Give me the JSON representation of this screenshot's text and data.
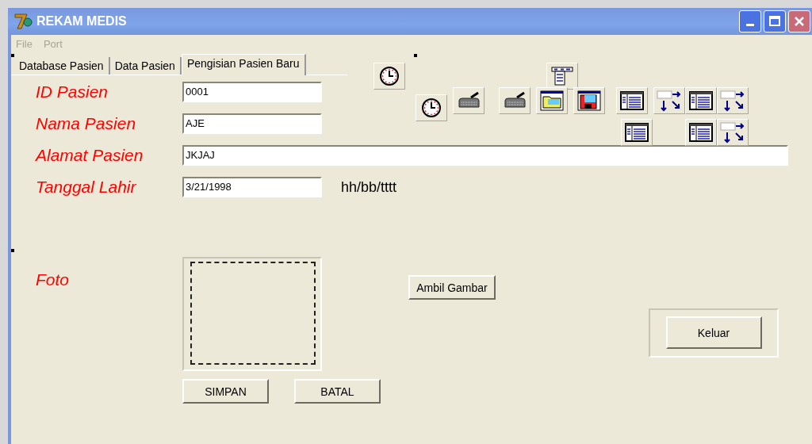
{
  "window": {
    "title": "REKAM MEDIS"
  },
  "menu": [
    {
      "label": "File",
      "disabled": true
    },
    {
      "label": "Port",
      "disabled": true
    }
  ],
  "tabs": [
    {
      "label": "Database Pasien",
      "selected": false
    },
    {
      "label": "Data Pasien",
      "selected": false
    },
    {
      "label": "Pengisian Pasien Baru",
      "selected": true
    }
  ],
  "fields": [
    {
      "label": "ID Pasien",
      "value": "0001",
      "kind": "short"
    },
    {
      "label": "Nama Pasien",
      "value": "AJE",
      "kind": "short"
    },
    {
      "label": "Alamat Pasien",
      "value": "JKJAJ",
      "kind": "long"
    },
    {
      "label": "Tanggal Lahir",
      "value": "3/21/1998",
      "kind": "short",
      "hint": "hh/bb/tttt"
    }
  ],
  "photo": {
    "label": "Foto",
    "button": "Ambil Gambar"
  },
  "buttons": [
    "SIMPAN",
    "BATAL"
  ],
  "exit_button": "Keluar"
}
